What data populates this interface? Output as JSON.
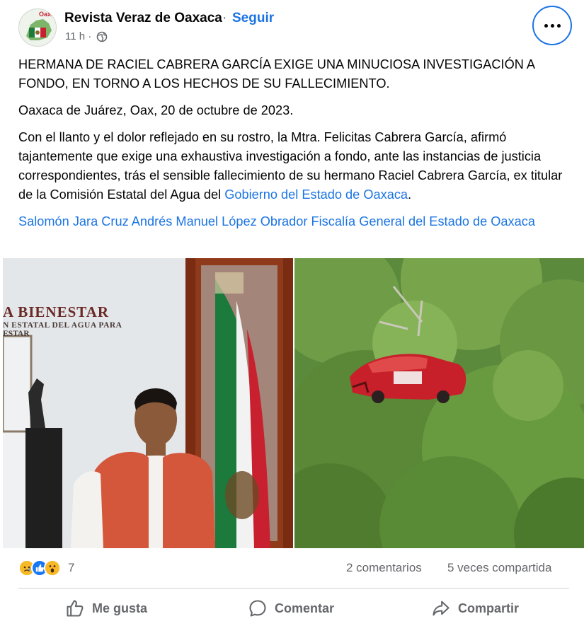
{
  "header": {
    "page_name": "Revista Veraz de Oaxaca",
    "separator": "·",
    "follow_label": "Seguir",
    "time_ago": "11 h ·",
    "avatar_text": "Oax."
  },
  "post": {
    "title": "HERMANA DE RACIEL CABRERA GARCÍA EXIGE UNA MINUCIOSA INVESTIGACIÓN A FONDO, EN TORNO A LOS HECHOS DE SU FALLECIMIENTO.",
    "dateline": "Oaxaca de Juárez, Oax, 20 de octubre de 2023.",
    "paragraph_text": "Con el llanto y el dolor reflejado en su rostro, la Mtra. Felicitas Cabrera García, afirmó tajantemente que exige una exhaustiva investigación a fondo, ante las instancias de justicia correspondientes, trás el sensible fallecimiento de su hermano Raciel Cabrera García, ex titular de la Comisión Estatal del Agua del ",
    "paragraph_link": "Gobierno del Estado de Oaxaca",
    "paragraph_end": ".",
    "tags": [
      "Salomón Jara Cruz",
      "Andrés Manuel López Obrador",
      "Fiscalía General del Estado de Oaxaca"
    ]
  },
  "photos": {
    "left_sign_line1": "A BIENESTAR",
    "left_sign_line2": "N ESTATAL DEL AGUA PARA",
    "left_sign_line3": "ESTAR"
  },
  "stats": {
    "reaction_count": "7",
    "comments": "2 comentarios",
    "shares": "5 veces compartida"
  },
  "actions": {
    "like": "Me gusta",
    "comment": "Comentar",
    "share": "Compartir"
  },
  "colors": {
    "link": "#1b74e4",
    "secondary_text": "#65676b",
    "like_blue": "#1877f2",
    "reaction_yellow": "#f7b928"
  }
}
